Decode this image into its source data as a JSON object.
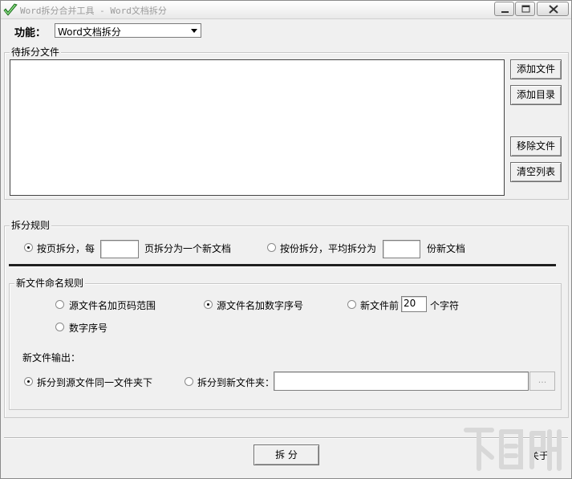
{
  "window": {
    "title": "Word拆分合并工具 - Word文档拆分",
    "controls": [
      "minimize",
      "maximize",
      "close"
    ],
    "app_icon": "green-check-icon"
  },
  "function": {
    "label": "功能：",
    "selected": "Word文档拆分"
  },
  "files_group": {
    "title": "待拆分文件",
    "buttons": {
      "add_file": "添加文件",
      "add_folder": "添加目录",
      "remove_file": "移除文件",
      "clear_list": "清空列表"
    }
  },
  "split_rules": {
    "title": "拆分规则",
    "by_page": {
      "label": "按页拆分，每",
      "value": "",
      "suffix": "页拆分为一个新文档",
      "selected": true
    },
    "by_count": {
      "label": "按份拆分，平均拆分为",
      "value": "",
      "suffix": "份新文档",
      "selected": false
    }
  },
  "naming": {
    "title": "新文件命名规则",
    "options": {
      "page_range": {
        "label": "源文件名加页码范围",
        "selected": false
      },
      "serial_suffix": {
        "label": "源文件名加数字序号",
        "selected": true
      },
      "first_chars": {
        "label": "新文件前",
        "value": "20",
        "suffix": "个字符",
        "selected": false
      },
      "number_only": {
        "label": "数字序号",
        "selected": false
      }
    },
    "output_label": "新文件输出：",
    "output": {
      "same_folder": {
        "label": "拆分到源文件同一文件夹下",
        "selected": true
      },
      "new_folder": {
        "label": "拆分到新文件夹：",
        "value": "",
        "selected": false
      },
      "browse_label": "..."
    }
  },
  "actions": {
    "split": "拆 分",
    "about": "关于"
  },
  "watermark": "下载吧",
  "colors": {
    "window_bg": "#f0f0f0",
    "icon_green": "#2e9e2e"
  }
}
